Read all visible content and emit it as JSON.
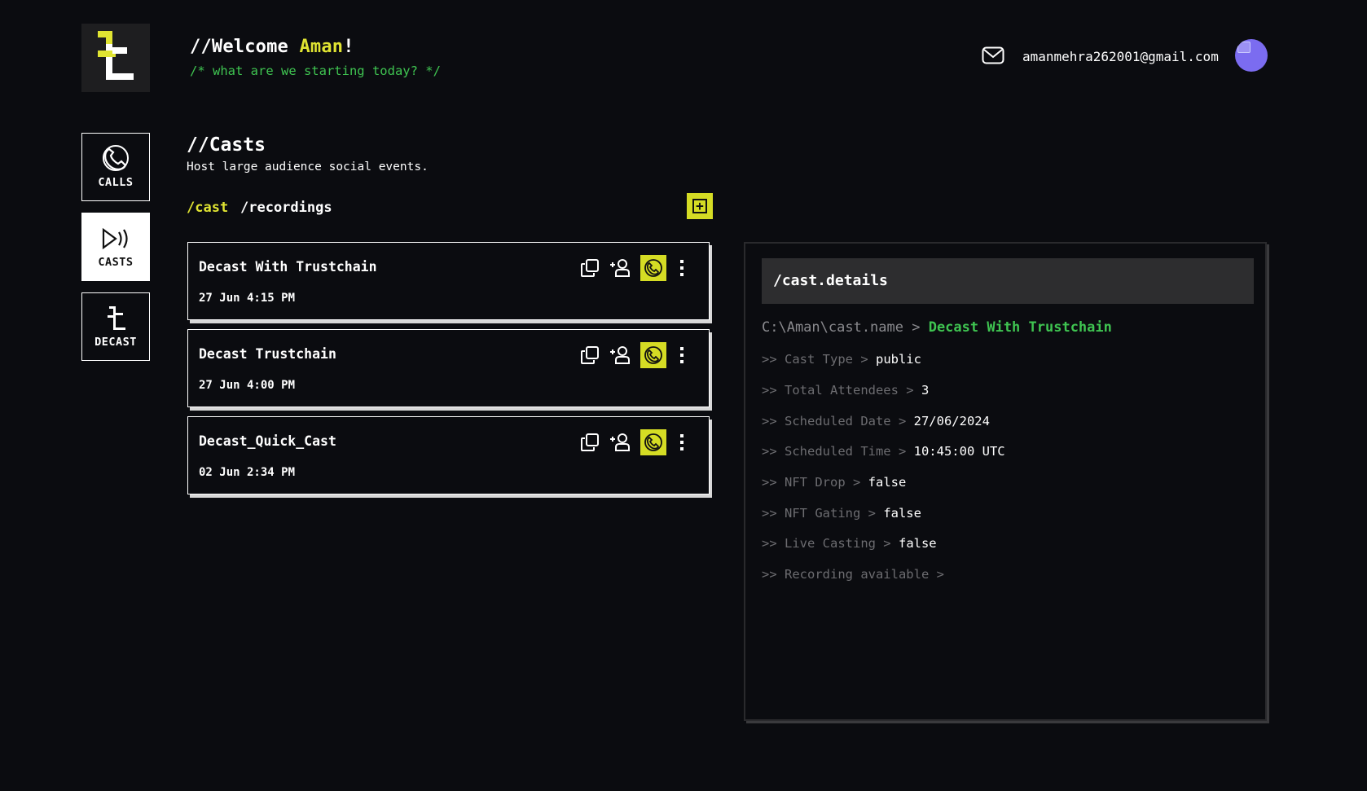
{
  "header": {
    "welcome_prefix": "//Welcome ",
    "user_name": "Aman",
    "welcome_suffix": "!",
    "subtitle": "/* what are we starting today? */",
    "email": "amanmehra262001@gmail.com"
  },
  "nav": {
    "items": [
      {
        "label": "CALLS",
        "icon": "phone-icon",
        "active": false
      },
      {
        "label": "CASTS",
        "icon": "broadcast-icon",
        "active": true
      },
      {
        "label": "DECAST",
        "icon": "decast-icon",
        "active": false
      }
    ]
  },
  "section": {
    "title": "//Casts",
    "subtitle": "Host large audience social events."
  },
  "tabs": {
    "cast": "/cast",
    "recordings": "/recordings",
    "add_label": "+"
  },
  "casts": [
    {
      "name": "Decast With Trustchain",
      "date": "27 Jun 4:15 PM"
    },
    {
      "name": "Decast Trustchain",
      "date": "27 Jun 4:00 PM"
    },
    {
      "name": "Decast_Quick_Cast",
      "date": "02 Jun 2:34 PM"
    }
  ],
  "details": {
    "title": "/cast.details",
    "path_prefix": "C:\\Aman\\cast.name > ",
    "name": "Decast With Trustchain",
    "rows": [
      {
        "label": ">> Cast Type > ",
        "value": "public"
      },
      {
        "label": ">> Total Attendees > ",
        "value": "3"
      },
      {
        "label": ">> Scheduled Date > ",
        "value": "27/06/2024"
      },
      {
        "label": ">> Scheduled Time > ",
        "value": "10:45:00 UTC"
      },
      {
        "label": ">> NFT Drop > ",
        "value": "false"
      },
      {
        "label": ">> NFT Gating > ",
        "value": "false"
      },
      {
        "label": ">> Live Casting > ",
        "value": "false"
      },
      {
        "label": ">> Recording available > ",
        "value": ""
      }
    ]
  },
  "colors": {
    "accent": "#d5dc24",
    "green": "#3fc451",
    "background": "#0b0c10"
  }
}
